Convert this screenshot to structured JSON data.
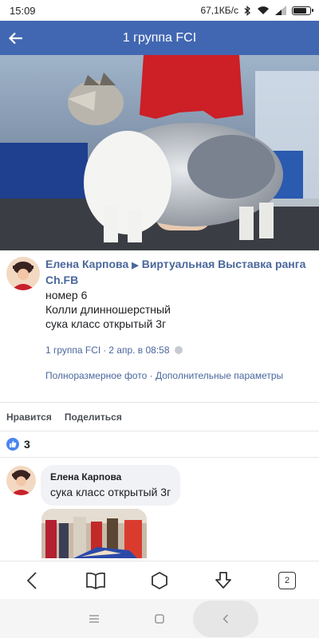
{
  "status_bar": {
    "time": "15:09",
    "net_speed": "67,1КБ/с",
    "battery_level": 0.85
  },
  "app_bar": {
    "title": "1 группа FCI",
    "back_icon": "arrow-left-icon"
  },
  "post": {
    "author": "Елена Карпова",
    "group": "Виртуальная Выставка ранга Ch.FB",
    "text": "номер 6\nКолли длинношерстный\nсука класс открытый 3г",
    "meta_source": "1 группа FCI",
    "meta_date": "2 апр. в 08:58",
    "link_full_photo": "Полноразмерное фото",
    "link_separator": "·",
    "link_more": "Дополнительные параметры"
  },
  "actions": {
    "like_label": "Нравится",
    "share_label": "Поделиться"
  },
  "likes": {
    "count": "3"
  },
  "comment": {
    "author": "Елена Карпова",
    "text": "сука класс открытый 3г"
  },
  "browser_nav": {
    "tab_count": "2"
  },
  "colors": {
    "app_bar": "#4267b2",
    "link": "#4b679c",
    "like": "#4b86f0"
  }
}
